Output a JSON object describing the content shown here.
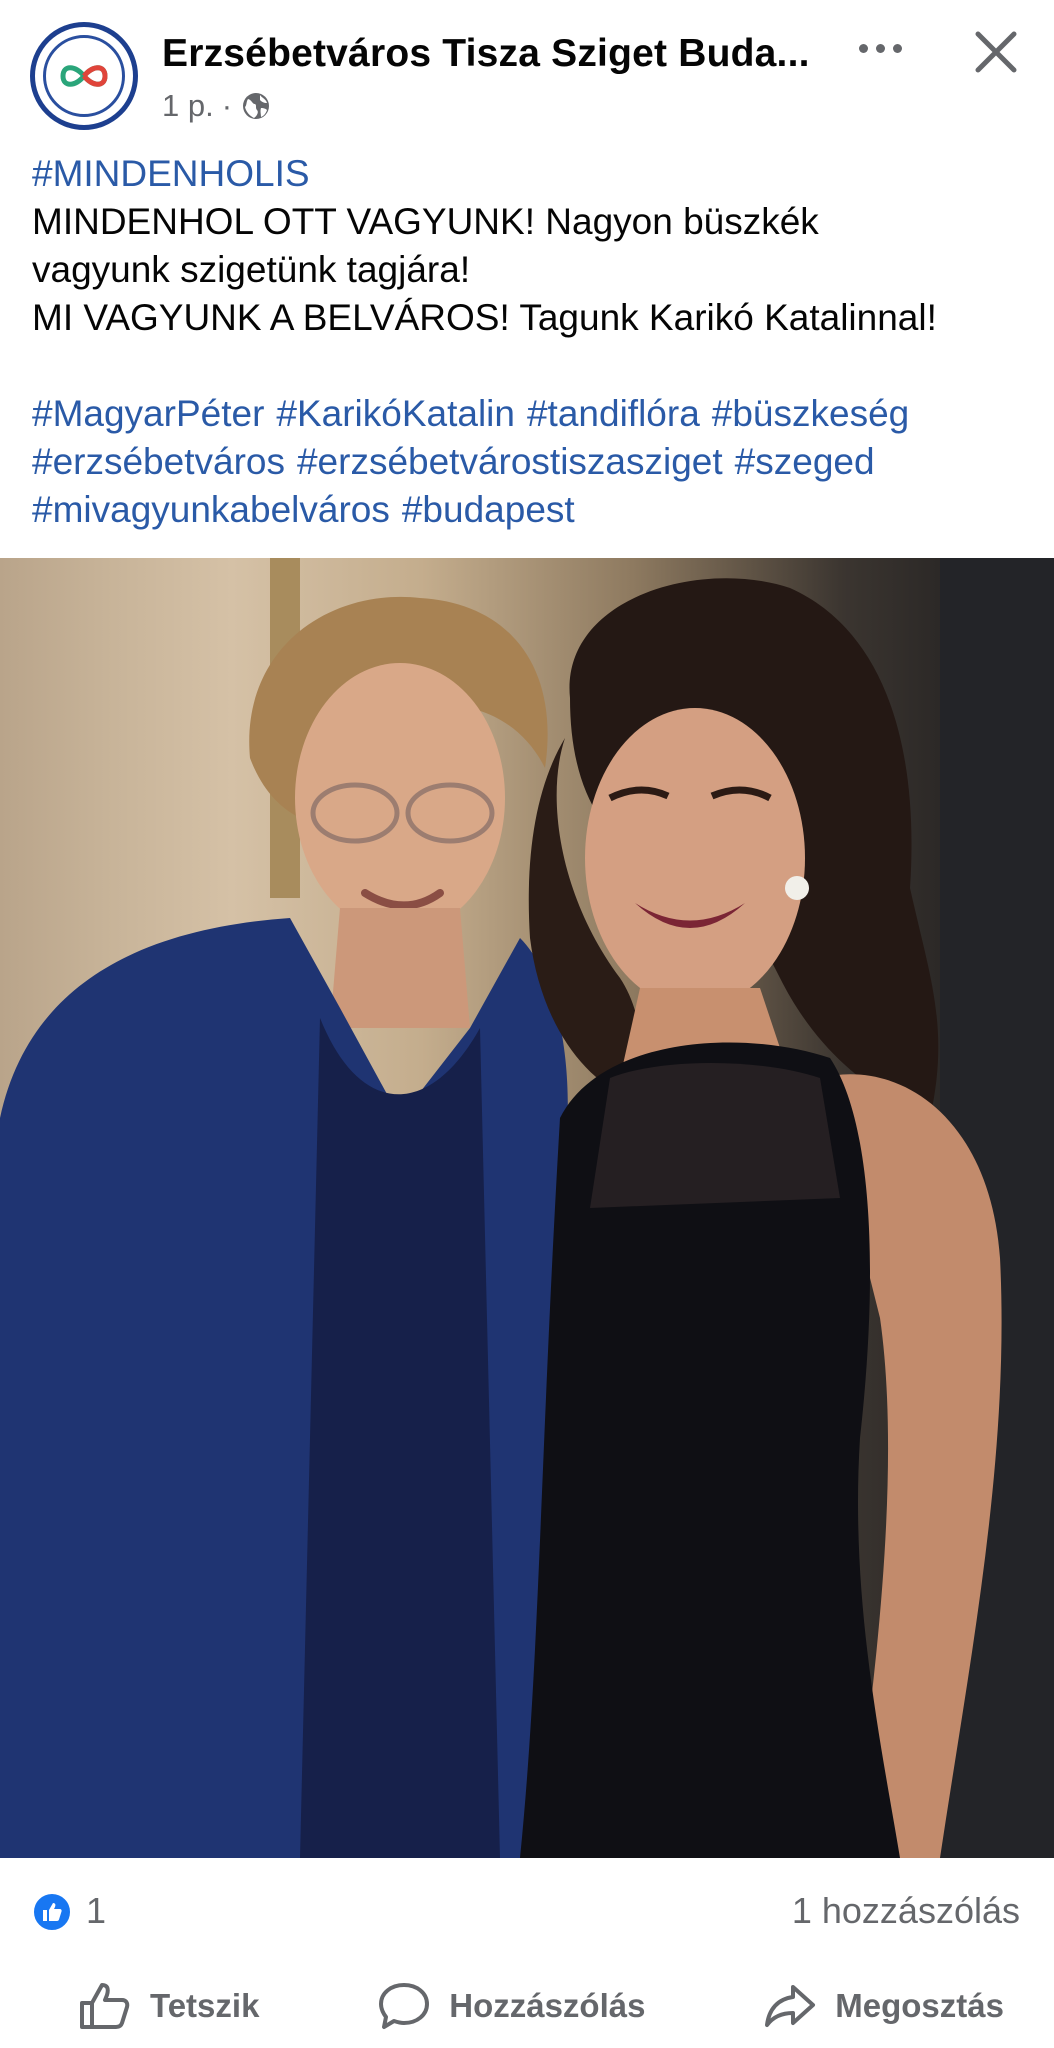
{
  "header": {
    "page_name": "Erzsébetváros Tisza Sziget Buda...",
    "time": "1 p.",
    "separator": "·",
    "audience_icon": "globe-icon",
    "more_icon": "more-dots-icon",
    "close_icon": "close-icon"
  },
  "post": {
    "hashtag_top": "#MINDENHOLIS",
    "lines": [
      "MINDENHOL OTT VAGYUNK! Nagyon büszkék",
      "vagyunk szigetünk tagjára!",
      "MI VAGYUNK A BELVÁROS! Tagunk Karikó Katalinnal!"
    ],
    "hashtags": [
      [
        "#MagyarPéter",
        "#KarikóKatalin",
        "#tandiflóra",
        "#büszkeség"
      ],
      [
        "#erzsébetváros",
        "#erzsébetvárostiszasziget",
        "#szeged"
      ],
      [
        "#mivagyunkabelváros",
        "#budapest"
      ]
    ]
  },
  "reactions": {
    "like_icon": "like-reaction-icon",
    "like_count": "1",
    "comment_count": "1 hozzászólás"
  },
  "actions": {
    "like": "Tetszik",
    "comment": "Hozzászólás",
    "share": "Megosztás"
  },
  "colors": {
    "link": "#2a5aa7",
    "secondary": "#65676b",
    "like_blue": "#1877f2"
  }
}
